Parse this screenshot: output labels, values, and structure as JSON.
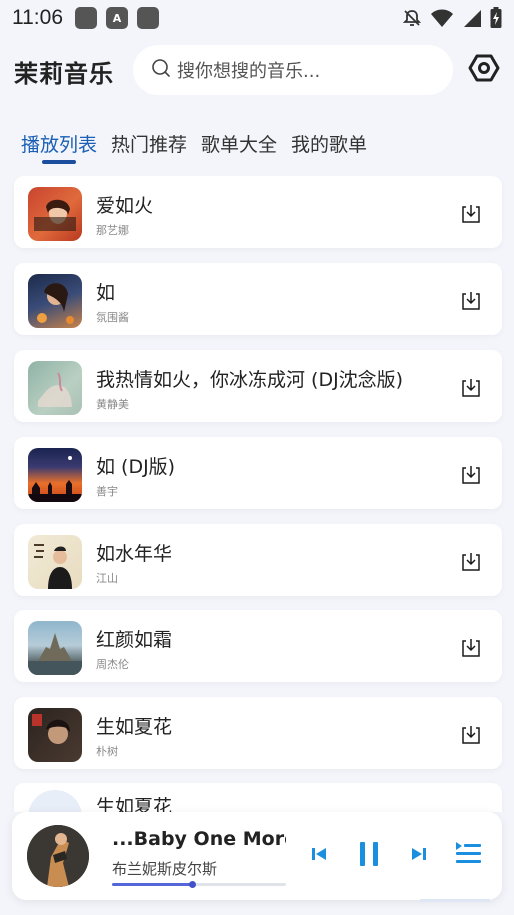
{
  "status_bar": {
    "time": "11:06",
    "icons": [
      "app-icon",
      "a-icon",
      "app-icon",
      "mute-icon",
      "wifi-icon",
      "signal-icon",
      "battery-charging-icon"
    ]
  },
  "header": {
    "app_title": "茉莉音乐",
    "search_placeholder": "搜你想搜的音乐...",
    "icons": {
      "search": "search-icon",
      "settings": "settings-hexagon-icon"
    }
  },
  "tabs": [
    {
      "label": "播放列表",
      "active": true
    },
    {
      "label": "热门推荐",
      "active": false
    },
    {
      "label": "歌单大全",
      "active": false
    },
    {
      "label": "我的歌单",
      "active": false
    }
  ],
  "songs": [
    {
      "title": "爱如火",
      "artist": "那艺娜"
    },
    {
      "title": "如",
      "artist": "氛围酱"
    },
    {
      "title": "我热情如火，你冰冻成河 (DJ沈念版)",
      "artist": "黄静美"
    },
    {
      "title": "如 (DJ版)",
      "artist": "善宇"
    },
    {
      "title": "如水年华",
      "artist": "江山"
    },
    {
      "title": "红颜如霜",
      "artist": "周杰伦"
    },
    {
      "title": "生如夏花",
      "artist": "朴树"
    },
    {
      "title": "生如夏花",
      "artist": ""
    }
  ],
  "player": {
    "title": "...Baby One More Tir",
    "artist": "布兰妮斯皮尔斯",
    "progress": 0.46,
    "icons": [
      "previous-icon",
      "pause-icon",
      "next-icon",
      "playlist-icon"
    ]
  },
  "colors": {
    "accent": "#1b5fb5",
    "player_icon": "#1a8fe0",
    "background": "#f3f5fb"
  }
}
